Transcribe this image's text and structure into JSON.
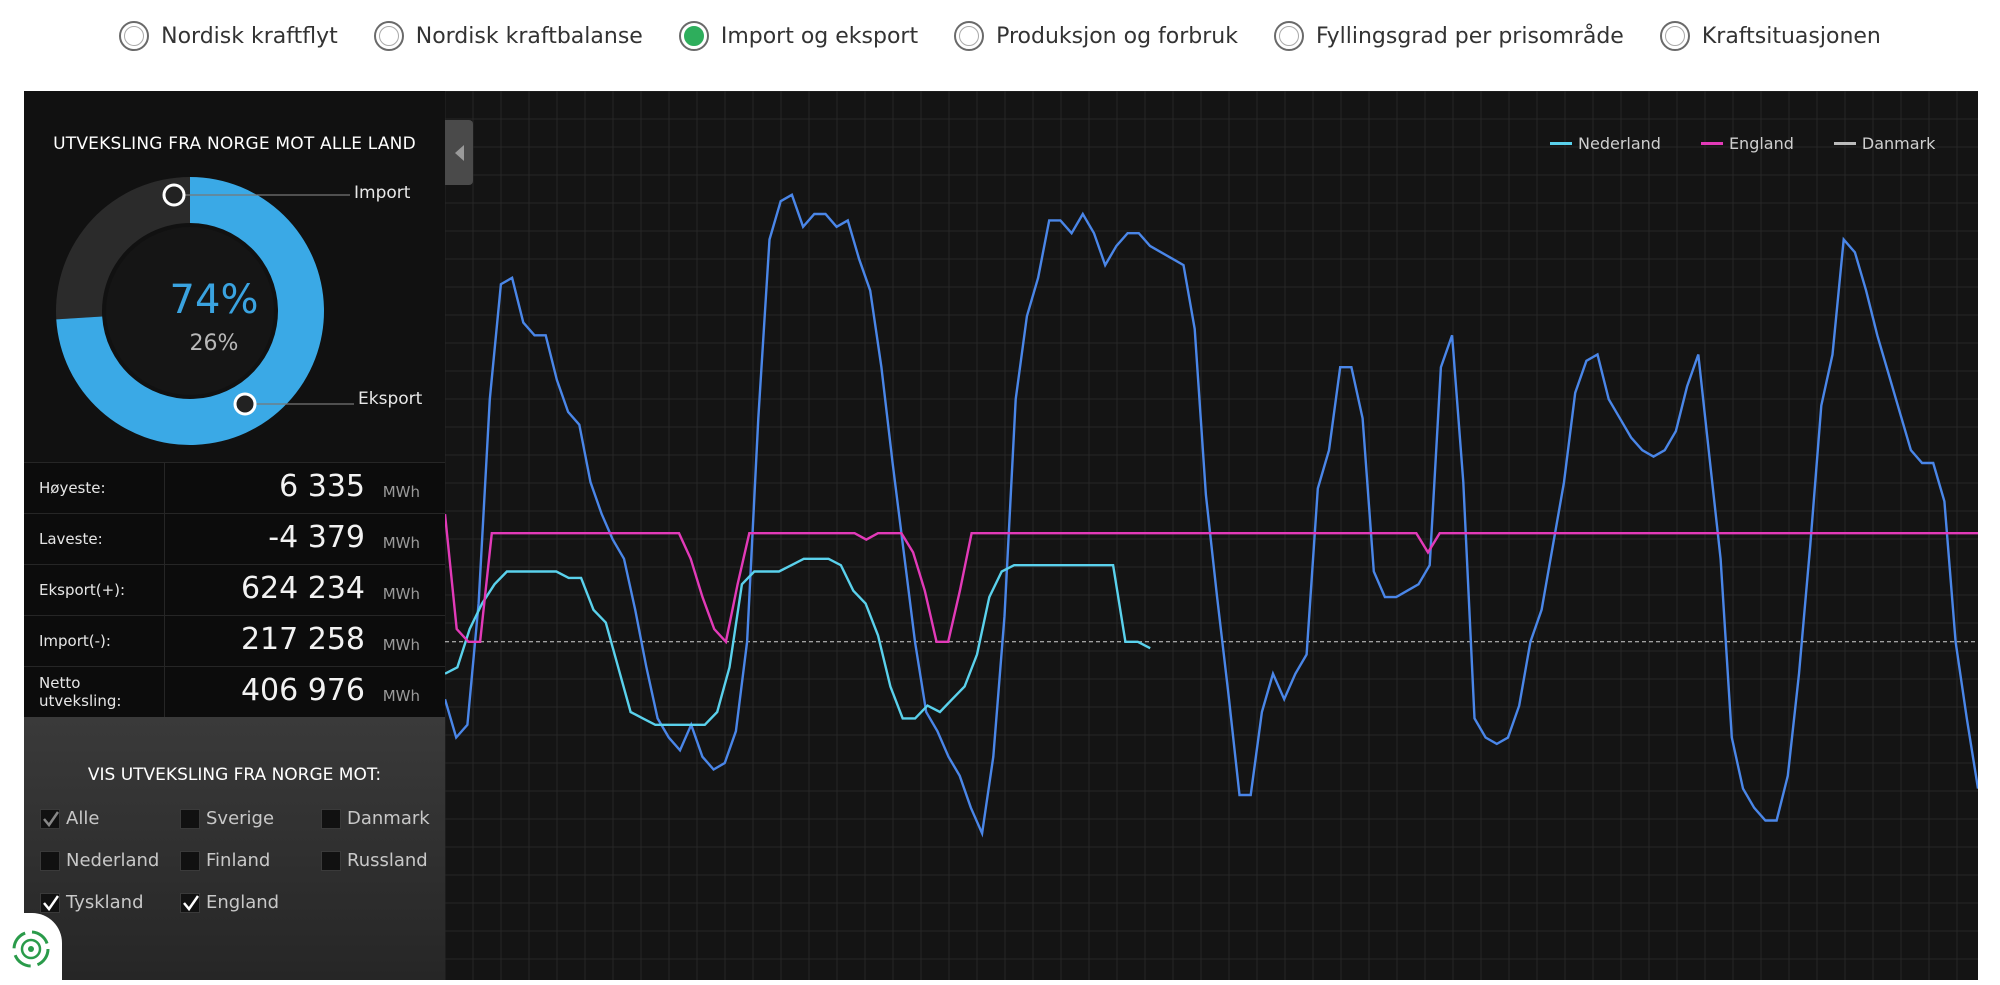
{
  "nav": {
    "options": [
      {
        "label": "Nordisk kraftflyt",
        "selected": false
      },
      {
        "label": "Nordisk kraftbalanse",
        "selected": false
      },
      {
        "label": "Import og eksport",
        "selected": true
      },
      {
        "label": "Produksjon og forbruk",
        "selected": false
      },
      {
        "label": "Fyllingsgrad per prisområde",
        "selected": false
      },
      {
        "label": "Kraftsituasjonen",
        "selected": false
      }
    ]
  },
  "donut": {
    "title": "UTVEKSLING FRA NORGE MOT ALLE LAND",
    "import_label": "Import",
    "eksport_label": "Eksport",
    "primary_percent": "74%",
    "secondary_percent": "26%",
    "primary_fraction": 0.74,
    "primary_color": "#3aa9e6",
    "secondary_color": "#2b2b2b"
  },
  "stats": [
    {
      "label": "Høyeste:",
      "value": "6 335",
      "unit": "MWh"
    },
    {
      "label": "Laveste:",
      "value": "-4 379",
      "unit": "MWh"
    },
    {
      "label": "Eksport(+):",
      "value": "624 234",
      "unit": "MWh"
    },
    {
      "label": "Import(-):",
      "value": "217 258",
      "unit": "MWh"
    },
    {
      "label": "Netto utveksling:",
      "value": "406 976",
      "unit": "MWh"
    }
  ],
  "filter": {
    "title": "VIS UTVEKSLING FRA NORGE MOT:",
    "options": [
      {
        "label": "Alle",
        "checked": true,
        "dim": true
      },
      {
        "label": "Sverige",
        "checked": false
      },
      {
        "label": "Danmark",
        "checked": false
      },
      {
        "label": "Nederland",
        "checked": false
      },
      {
        "label": "Finland",
        "checked": false
      },
      {
        "label": "Russland",
        "checked": false
      },
      {
        "label": "Tyskland",
        "checked": true
      },
      {
        "label": "England",
        "checked": true
      }
    ]
  },
  "chart_data": {
    "type": "line",
    "zero_line_value": 0,
    "ylim": [
      -5000,
      8000
    ],
    "grid": true,
    "legend_placement": "top-right",
    "legend": [
      {
        "label": "Nederland",
        "color": "#5ad1ec"
      },
      {
        "label": "England",
        "color": "#e23ab8"
      },
      {
        "label": "Danmark",
        "color": "#bbbbbb"
      }
    ],
    "series": [
      {
        "color": "#4a86e8",
        "values": [
          -900,
          -1500,
          -1300,
          600,
          3800,
          5600,
          5700,
          5000,
          4800,
          4800,
          4100,
          3600,
          3400,
          2500,
          2000,
          1600,
          1300,
          500,
          -400,
          -1200,
          -1500,
          -1700,
          -1300,
          -1800,
          -2000,
          -1900,
          -1400,
          0,
          3500,
          6300,
          6900,
          7000,
          6500,
          6700,
          6700,
          6500,
          6600,
          6000,
          5500,
          4300,
          2800,
          1400,
          0,
          -1100,
          -1400,
          -1800,
          -2100,
          -2600,
          -3000,
          -1800,
          400,
          3800,
          5100,
          5700,
          6600,
          6600,
          6400,
          6700,
          6400,
          5900,
          6200,
          6400,
          6400,
          6200,
          6100,
          6000,
          5900,
          4900,
          2300,
          700,
          -800,
          -2400,
          -2400,
          -1100,
          -500,
          -900,
          -500,
          -200,
          2400,
          3000,
          4300,
          4300,
          3500,
          1100,
          700,
          700,
          800,
          900,
          1200,
          4300,
          4800,
          2500,
          -1200,
          -1500,
          -1600,
          -1500,
          -1000,
          0,
          500,
          1500,
          2500,
          3900,
          4400,
          4500,
          3800,
          3500,
          3200,
          3000,
          2900,
          3000,
          3300,
          4000,
          4500,
          2900,
          1300,
          -1500,
          -2300,
          -2600,
          -2800,
          -2800,
          -2100,
          -500,
          1500,
          3700,
          4500,
          6300,
          6100,
          5500,
          4800,
          4200,
          3600,
          3000,
          2800,
          2800,
          2200,
          0,
          -1200,
          -2300
        ],
        "name": ""
      },
      {
        "color": "#5ad1ec",
        "values": [
          -500,
          -400,
          200,
          600,
          900,
          1100,
          1100,
          1100,
          1100,
          1100,
          1000,
          1000,
          500,
          300,
          -400,
          -1100,
          -1200,
          -1300,
          -1300,
          -1300,
          -1300,
          -1300,
          -1100,
          -400,
          900,
          1100,
          1100,
          1100,
          1200,
          1300,
          1300,
          1300,
          1200,
          800,
          600,
          100,
          -700,
          -1200,
          -1200,
          -1000,
          -1100,
          -900,
          -700,
          -200,
          700,
          1100,
          1200,
          1200,
          1200,
          1200,
          1200,
          1200,
          1200,
          1200,
          1200,
          0,
          0,
          -100
        ],
        "name": ""
      },
      {
        "color": "#e23ab8",
        "values": [
          2000,
          200,
          0,
          0,
          1700,
          1700,
          1700,
          1700,
          1700,
          1700,
          1700,
          1700,
          1700,
          1700,
          1700,
          1700,
          1700,
          1700,
          1700,
          1700,
          1700,
          1300,
          700,
          200,
          0,
          900,
          1700,
          1700,
          1700,
          1700,
          1700,
          1700,
          1700,
          1700,
          1700,
          1700,
          1600,
          1700,
          1700,
          1700,
          1400,
          800,
          0,
          0,
          800,
          1700,
          1700,
          1700,
          1700,
          1700,
          1700,
          1700,
          1700,
          1700,
          1700,
          1700,
          1700,
          1700,
          1700,
          1700,
          1700,
          1700,
          1700,
          1700,
          1700,
          1700,
          1700,
          1700,
          1700,
          1700,
          1700,
          1700,
          1700,
          1700,
          1700,
          1700,
          1700,
          1700,
          1700,
          1700,
          1700,
          1700,
          1700,
          1700,
          1400,
          1700,
          1700,
          1700,
          1700,
          1700,
          1700,
          1700,
          1700,
          1700,
          1700,
          1700,
          1700,
          1700,
          1700,
          1700,
          1700,
          1700,
          1700,
          1700,
          1700,
          1700,
          1700,
          1700,
          1700,
          1700,
          1700,
          1700,
          1700,
          1700,
          1700,
          1700,
          1700,
          1700,
          1700,
          1700,
          1700,
          1700,
          1700,
          1700,
          1700,
          1700,
          1700,
          1700,
          1700,
          1700,
          1700,
          1700
        ],
        "name": ""
      }
    ]
  }
}
